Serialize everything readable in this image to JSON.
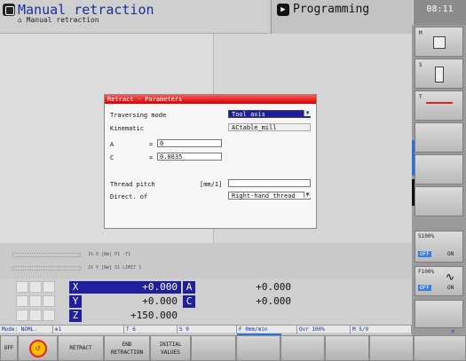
{
  "header": {
    "title": "Manual retraction",
    "subtitle": "Manual retraction",
    "programming_label": "Programming",
    "clock": "08:11"
  },
  "dialog": {
    "title": "Retract - Parameters",
    "fields": [
      {
        "label": "Traversing mode",
        "value": "Tool axis"
      },
      {
        "label": "Kinematic",
        "value": "ACtable_mill"
      },
      {
        "label": "A",
        "eq": "=",
        "value": "0"
      },
      {
        "label": "C",
        "eq": "=",
        "value": "0.0035"
      },
      {
        "label": "Thread pitch",
        "unit": "[mm/1]",
        "value": ""
      },
      {
        "label": "Direct. of",
        "value": "Right-hand thread"
      }
    ]
  },
  "status_rows": [
    {
      "text": "1% X [Nm]  P1  -T1"
    },
    {
      "text": "1% Y [Nm]  S1  LIMIT 1"
    }
  ],
  "positions": [
    {
      "axis": "X",
      "value": "+0.000"
    },
    {
      "axis": "A",
      "value": "+0.000"
    },
    {
      "axis": "Y",
      "value": "+0.000"
    },
    {
      "axis": "C",
      "value": "+0.000"
    },
    {
      "axis": "Z",
      "value": "+150.000"
    }
  ],
  "statusbar": {
    "mode": "Mode: NOML.",
    "tool_ref": "1",
    "t": "T 6",
    "s": "S 0",
    "f": "F 0mm/min",
    "ovr": "Ovr 100%",
    "m": "M 5/9"
  },
  "softkeys": [
    {
      "label": "OFF",
      "label2": ""
    },
    {
      "label": "RETRACT",
      "label2": ""
    },
    {
      "label": "END",
      "label2": "RETRACTION"
    },
    {
      "label": "INITIAL",
      "label2": "VALUES"
    },
    {
      "label": "",
      "label2": ""
    },
    {
      "label": "",
      "label2": ""
    },
    {
      "label": "",
      "label2": ""
    },
    {
      "label": "",
      "label2": ""
    },
    {
      "label": "",
      "label2": ""
    }
  ],
  "right_panel": {
    "m_label": "M",
    "s_label": "S",
    "t_label": "T",
    "s_override": "S100%",
    "f_override": "F100%",
    "off": "OFF",
    "on": "ON"
  },
  "colors": {
    "axis_blue": "#1f1fa0",
    "title_red": "#e02020",
    "title_blue": "#1a2f9a",
    "off_blue": "#3b7ed8"
  }
}
